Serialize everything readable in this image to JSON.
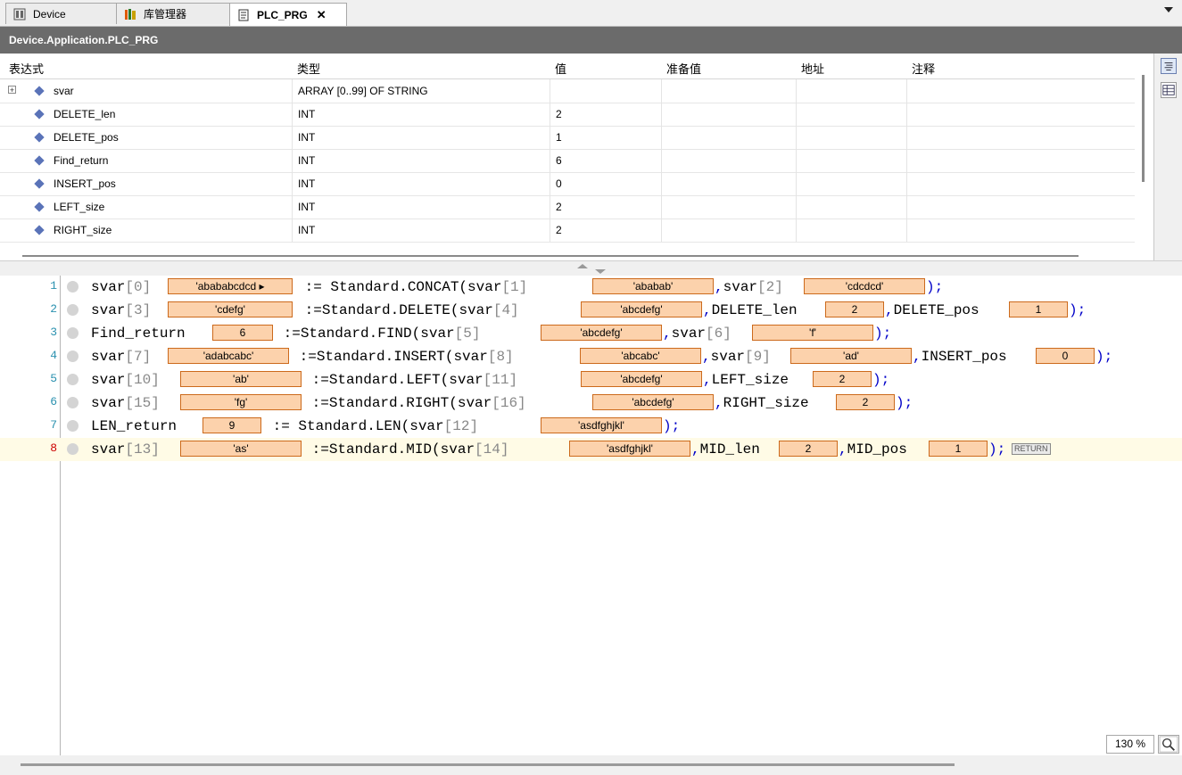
{
  "tabs": [
    {
      "label": "Device",
      "icon": "device-icon"
    },
    {
      "label": "库管理器",
      "icon": "library-icon"
    },
    {
      "label": "PLC_PRG",
      "icon": "document-icon",
      "close": "✕"
    }
  ],
  "title": "Device.Application.PLC_PRG",
  "watch": {
    "headers": [
      "表达式",
      "类型",
      "值",
      "准备值",
      "地址",
      "注释"
    ],
    "rows": [
      {
        "expand": "+",
        "name": "svar",
        "type": "ARRAY [0..99] OF STRING",
        "value": ""
      },
      {
        "name": "DELETE_len",
        "type": "INT",
        "value": "2"
      },
      {
        "name": "DELETE_pos",
        "type": "INT",
        "value": "1"
      },
      {
        "name": "Find_return",
        "type": "INT",
        "value": "6"
      },
      {
        "name": "INSERT_pos",
        "type": "INT",
        "value": "0"
      },
      {
        "name": "LEFT_size",
        "type": "INT",
        "value": "2"
      },
      {
        "name": "RIGHT_size",
        "type": "INT",
        "value": "2"
      }
    ]
  },
  "code": {
    "lines": [
      {
        "n": "1",
        "a": "svar",
        "b": "[0]",
        "v1": "'abababcdcd",
        "arrow": "▸",
        "c": " := ",
        "d": "Standard.CONCAT(svar",
        "e": "[1]",
        "v2": "'ababab'",
        "f": ",",
        "g": "svar",
        "h": "[2]",
        "v3": "'cdcdcd'",
        "i": ");"
      },
      {
        "n": "2",
        "a": "svar",
        "b": "[3]",
        "v1": "'cdefg'",
        "c": " :=",
        "d": "Standard.DELETE(svar",
        "e": "[4]",
        "v2": "'abcdefg'",
        "f": ",",
        "g": "DELETE_len",
        "v3": "2",
        "h2": ",",
        "g2": "DELETE_pos",
        "v4": "1",
        "i": ");"
      },
      {
        "n": "3",
        "a": "Find_return",
        "v1": "6",
        "c": " :=",
        "d": "Standard.FIND(svar",
        "e": "[5]",
        "v2": "'abcdefg'",
        "f": ",",
        "g": "svar",
        "h": "[6]",
        "v3": "'f'",
        "i": ");"
      },
      {
        "n": "4",
        "a": "svar",
        "b": "[7]",
        "v1": "'adabcabc'",
        "c": " :=",
        "d": "Standard.INSERT(svar",
        "e": "[8]",
        "v2": "'abcabc'",
        "f": ",",
        "g": "svar",
        "h": "[9]",
        "v3": "'ad'",
        "h2": ",",
        "g2": "INSERT_pos",
        "v4": "0",
        "i": ");"
      },
      {
        "n": "5",
        "a": "svar",
        "b": "[10]",
        "v1": "'ab'",
        "c": " :=",
        "d": "Standard.LEFT(svar",
        "e": "[11]",
        "v2": "'abcdefg'",
        "f": ",",
        "g": "LEFT_size",
        "v3": "2",
        "i": ");"
      },
      {
        "n": "6",
        "a": "svar",
        "b": "[15]",
        "v1": "'fg'",
        "c": " :=",
        "d": "Standard.RIGHT(svar",
        "e": "[16]",
        "v2": "'abcdefg'",
        "f": ",",
        "g": "RIGHT_size",
        "v3": "2",
        "i": ");"
      },
      {
        "n": "7",
        "a": "LEN_return",
        "v1": "9",
        "c": " := ",
        "d": "Standard.LEN(svar",
        "e": "[12]",
        "v2": "'asdfghjkl'",
        "i": ");"
      },
      {
        "n": "8",
        "a": "svar",
        "b": "[13]",
        "v1": "'as'",
        "c": " :=",
        "d": "Standard.MID(svar",
        "e": "[14]",
        "v2": "'asdfghjkl'",
        "f": ",",
        "g": "MID_len",
        "v3": "2",
        "h2": ",",
        "g2": "MID_pos",
        "v4": "1",
        "i": ");",
        "ret": "RETURN"
      }
    ]
  },
  "zoom": "130 %",
  "colors": {
    "title_bar": "#6b6b6b",
    "value_box": "#fcd2ac",
    "value_border": "#cc6a1c",
    "keyword_paren": "#0000c8",
    "line_number": "#2b91af"
  }
}
